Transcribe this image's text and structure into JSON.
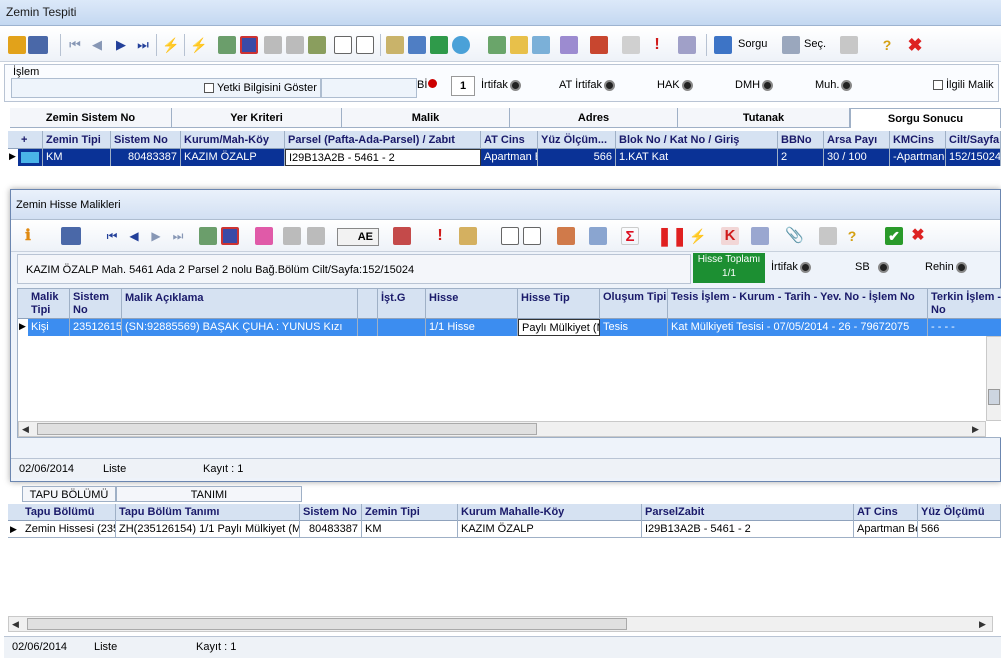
{
  "window": {
    "title": "Zemin Tespiti"
  },
  "toolbar": {
    "sorgu_label": "Sorgu",
    "sec_label": "Seç."
  },
  "islem": {
    "group_label": "İşlem",
    "yetki_label": "Yetki Bilgisini Göster",
    "bi_label": "Bİ",
    "bi_count": "1",
    "irtifak_label": "İrtifak",
    "at_irtifak_label": "AT İrtifak",
    "hak_label": "HAK",
    "dmh_label": "DMH",
    "muh_label": "Muh.",
    "ilgili_label": "İlgili Malik"
  },
  "tabs": [
    {
      "label": "Zemin Sistem No"
    },
    {
      "label": "Yer Kriteri"
    },
    {
      "label": "Malik"
    },
    {
      "label": "Adres"
    },
    {
      "label": "Tutanak"
    },
    {
      "label": "Sorgu Sonucu"
    }
  ],
  "main_grid": {
    "headers": [
      "+",
      "Zemin Tipi",
      "Sistem No",
      "Kurum/Mah-Köy",
      "Parsel (Pafta-Ada-Parsel) / Zabıt",
      "AT Cins",
      "Yüz Ölçüm...",
      "Blok No / Kat No / Giriş",
      "BBNo",
      "Arsa Payı",
      "KMCins",
      "Cilt/Sayfa"
    ],
    "row": [
      "",
      "KM",
      "80483387",
      "KAZIM ÖZALP",
      "I29B13A2B - 5461 - 2",
      "Apartman B",
      "566",
      "1.KAT Kat",
      "2",
      "30 / 100",
      "-Apartman-",
      "152/15024"
    ]
  },
  "dialog": {
    "title": "Zemin Hisse Malikleri",
    "ae_label": "AE",
    "info_text": "KAZIM ÖZALP Mah. 5461 Ada 2 Parsel 2 nolu Bağ.Bölüm  Cilt/Sayfa:152/15024",
    "hisse_toplami_label": "Hisse Toplamı",
    "hisse_toplami_value": "1/1",
    "irtifak_label": "İrtifak",
    "sb_label": "SB",
    "rehin_label": "Rehin",
    "headers": [
      "Malik Tipi",
      "Sistem No",
      "Malik Açıklama",
      "",
      "İşt.G",
      "Hisse",
      "Hisse Tip",
      "Oluşum Tipi",
      "Tesis İşlem - Kurum - Tarih - Yev. No - İşlem No",
      "Terkin İşlem - No"
    ],
    "row": [
      "Kişi",
      "23512615",
      "(SN:92885569) BAŞAK ÇUHA : YUNUS Kızı",
      "",
      "",
      "1/1 Hisse",
      "Paylı Mülkiyet (M",
      "Tesis",
      "Kat Mülkiyeti Tesisi - 07/05/2014 - 26 - 79672075",
      "- - - -"
    ],
    "status_date": "02/06/2014",
    "status_mode": "Liste",
    "status_count": "Kayıt : 1"
  },
  "lower": {
    "tabs": [
      {
        "label": "TAPU BÖLÜMÜ"
      },
      {
        "label": "TANIMI"
      }
    ],
    "headers": [
      "Tapu Bölümü",
      "Tapu Bölüm Tanımı",
      "Sistem No",
      "Zemin Tipi",
      "Kurum Mahalle-Köy",
      "ParselZabit",
      "AT Cins",
      "Yüz Ölçümü"
    ],
    "row": [
      "Zemin Hissesi  (235",
      "ZH(235126154)  1/1 Paylı Mülkiyet (M",
      "80483387",
      "KM",
      "KAZIM ÖZALP",
      "I29B13A2B - 5461 - 2",
      "Apartman Be",
      "566"
    ],
    "status_date": "02/06/2014",
    "status_mode": "Liste",
    "status_count": "Kayıt : 1"
  },
  "colors": {
    "selection": "#0a3296",
    "header_bg": "#d6e2f2",
    "green": "#1c8f32",
    "close_red": "#d22"
  }
}
